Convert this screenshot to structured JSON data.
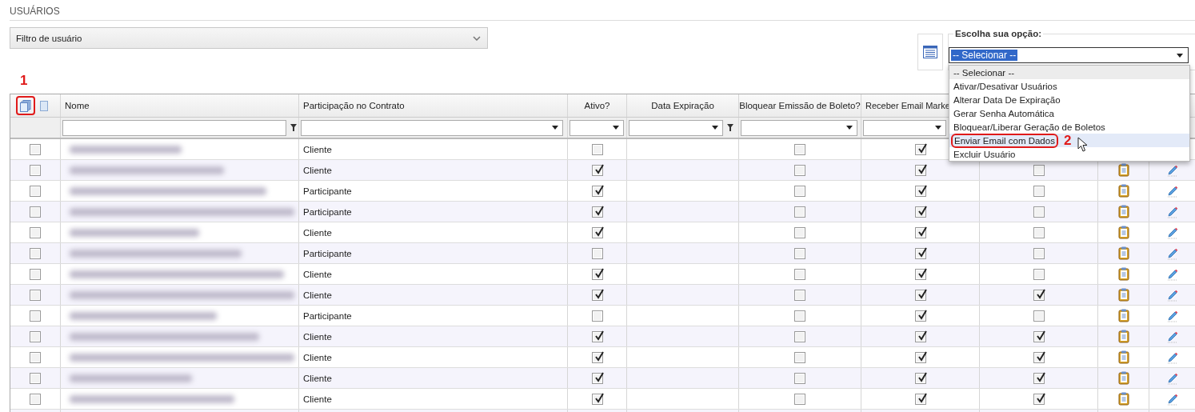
{
  "page_title": "USUÁRIOS",
  "filter_panel": {
    "label": "Filtro de usuário",
    "expanded": false
  },
  "action_panel": {
    "legend": "Escolha sua opção:",
    "value": "-- Selecionar --",
    "open": true,
    "options": [
      {
        "label": "-- Selecionar --",
        "selected": true,
        "hovered": false
      },
      {
        "label": "Ativar/Desativar Usuários",
        "selected": false,
        "hovered": false
      },
      {
        "label": "Alterar Data De Expiração",
        "selected": false,
        "hovered": false
      },
      {
        "label": "Gerar Senha Automática",
        "selected": false,
        "hovered": false
      },
      {
        "label": "Bloquear/Liberar Geração de Boletos",
        "selected": false,
        "hovered": false
      },
      {
        "label": "Enviar Email com Dados",
        "selected": false,
        "hovered": true
      },
      {
        "label": "Excluir Usuário",
        "selected": false,
        "hovered": false
      }
    ]
  },
  "annotations": [
    {
      "label": "1"
    },
    {
      "label": "2"
    }
  ],
  "table": {
    "columns": [
      "Nome",
      "Participação no Contrato",
      "Ativo?",
      "Data Expiração",
      "Bloquear Emissão de Boleto?",
      "Receber Email Marke"
    ],
    "rows": [
      {
        "selected": false,
        "participacao": "Cliente",
        "ativo": false,
        "bloquear": false,
        "receber": true
      },
      {
        "selected": false,
        "participacao": "Cliente",
        "ativo": true,
        "bloquear": false,
        "receber": true,
        "column_7": false
      },
      {
        "selected": false,
        "participacao": "Participante",
        "ativo": true,
        "bloquear": false,
        "receber": true,
        "column_7": false
      },
      {
        "selected": false,
        "participacao": "Participante",
        "ativo": true,
        "bloquear": false,
        "receber": true,
        "column_7": false
      },
      {
        "selected": false,
        "participacao": "Cliente",
        "ativo": true,
        "bloquear": false,
        "receber": true,
        "column_7": false
      },
      {
        "selected": false,
        "participacao": "Participante",
        "ativo": false,
        "bloquear": false,
        "receber": true,
        "column_7": false
      },
      {
        "selected": false,
        "participacao": "Cliente",
        "ativo": true,
        "bloquear": false,
        "receber": true,
        "column_7": false
      },
      {
        "selected": false,
        "participacao": "Cliente",
        "ativo": true,
        "bloquear": false,
        "receber": true,
        "column_7": true
      },
      {
        "selected": false,
        "participacao": "Participante",
        "ativo": false,
        "bloquear": false,
        "receber": true,
        "column_7": false
      },
      {
        "selected": false,
        "participacao": "Cliente",
        "ativo": true,
        "bloquear": false,
        "receber": true,
        "column_7": true
      },
      {
        "selected": false,
        "participacao": "Cliente",
        "ativo": true,
        "bloquear": false,
        "receber": true,
        "column_7": true
      },
      {
        "selected": false,
        "participacao": "Cliente",
        "ativo": true,
        "bloquear": false,
        "receber": true,
        "column_7": true
      },
      {
        "selected": false,
        "participacao": "Cliente",
        "ativo": true,
        "bloquear": false,
        "receber": true,
        "column_7": true
      }
    ]
  }
}
